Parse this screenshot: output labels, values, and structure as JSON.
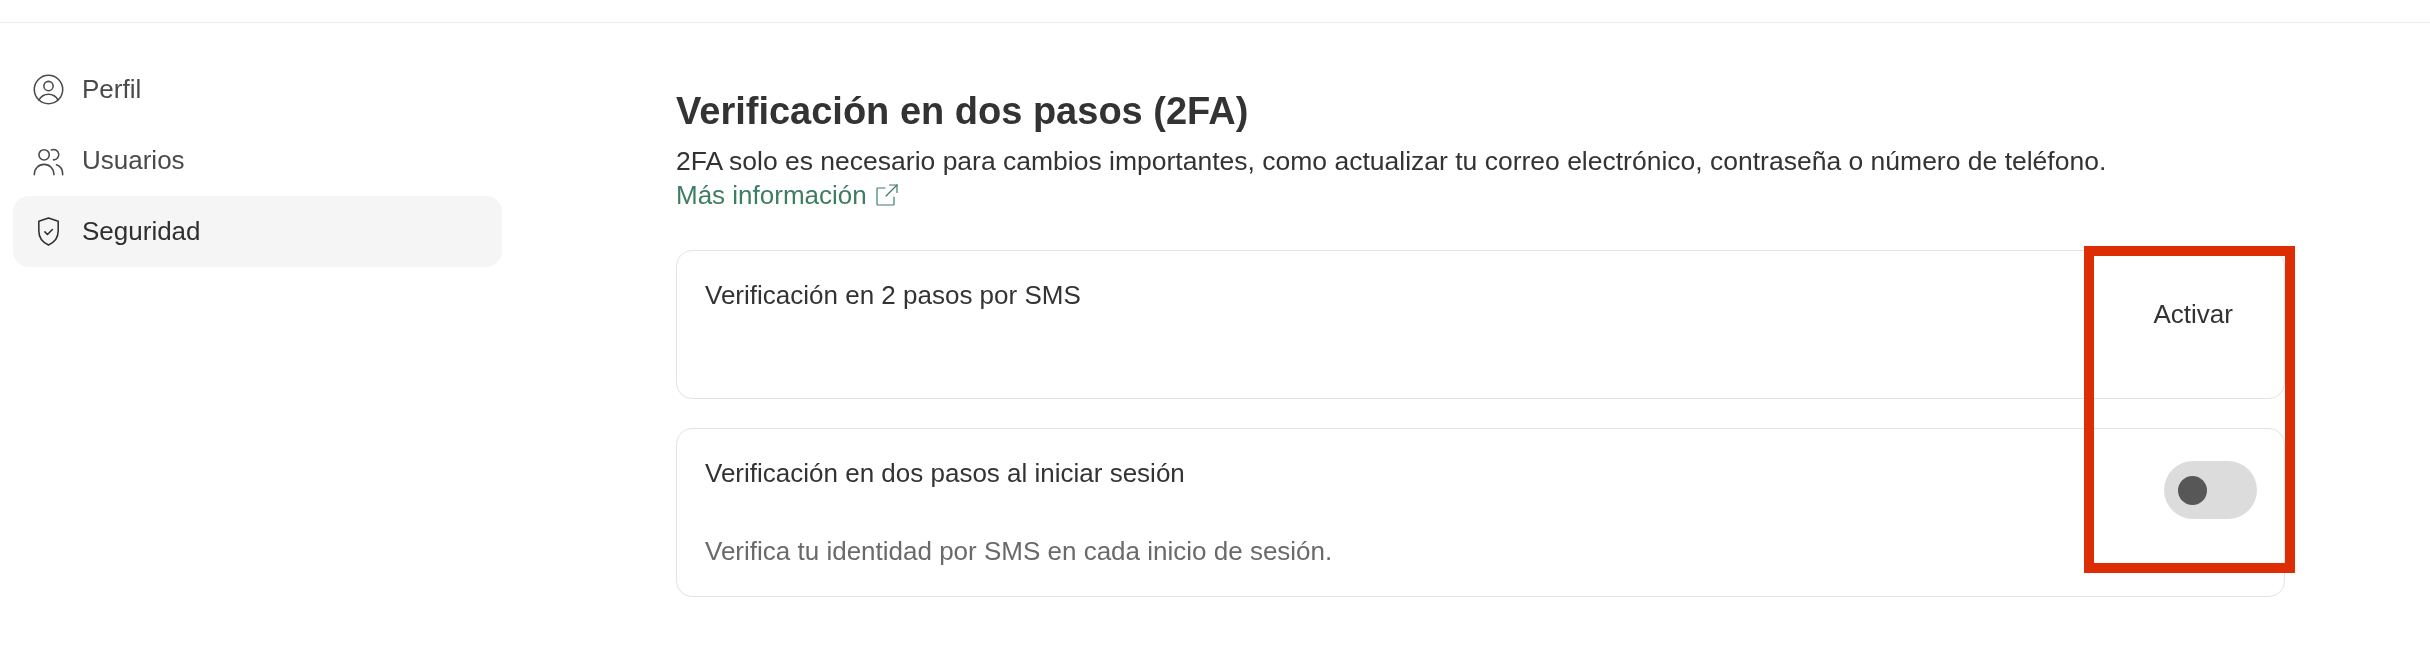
{
  "sidebar": {
    "items": [
      {
        "label": "Perfil",
        "selected": false
      },
      {
        "label": "Usuarios",
        "selected": false
      },
      {
        "label": "Seguridad",
        "selected": true
      }
    ]
  },
  "section": {
    "title": "Verificación en dos pasos (2FA)",
    "description": "2FA solo es necesario para cambios importantes, como actualizar tu correo electrónico, contraseña o número de teléfono.",
    "link": "Más información"
  },
  "settings": [
    {
      "kind": "action",
      "title": "Verificación en 2 pasos por SMS",
      "action": "Activar"
    },
    {
      "kind": "switch",
      "title": "Verificación en dos pasos al iniciar sesión",
      "description": "Verifica tu identidad por SMS en cada inicio de sesión.",
      "on": false
    }
  ],
  "annotation": {
    "kind": "frame"
  }
}
